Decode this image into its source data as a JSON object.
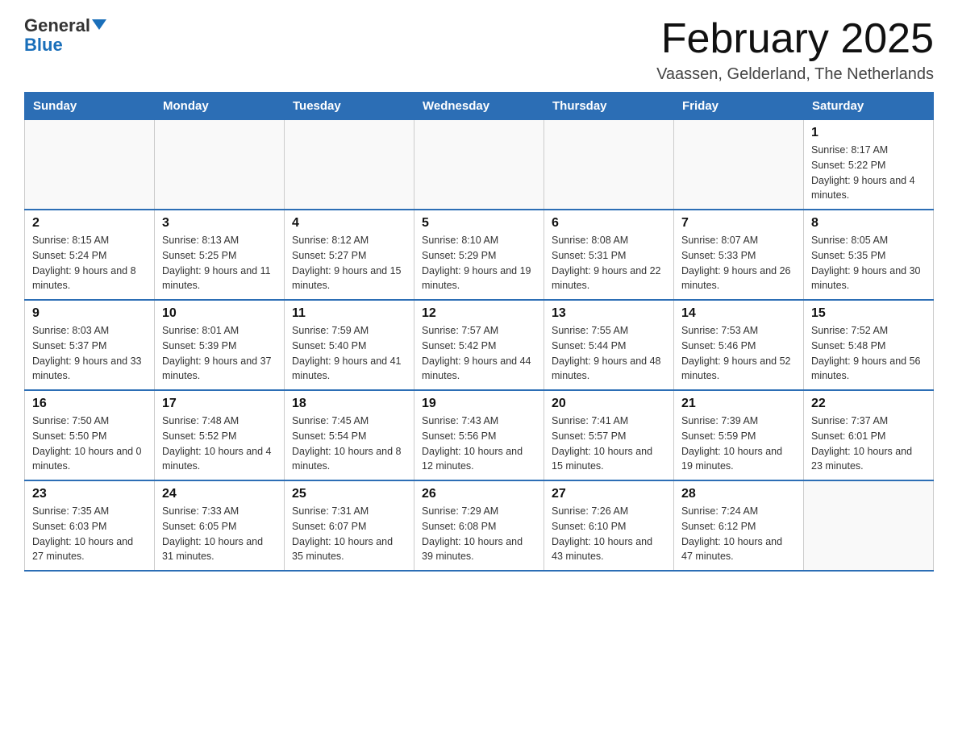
{
  "header": {
    "logo_general": "General",
    "logo_blue": "Blue",
    "month_title": "February 2025",
    "location": "Vaassen, Gelderland, The Netherlands"
  },
  "days_of_week": [
    "Sunday",
    "Monday",
    "Tuesday",
    "Wednesday",
    "Thursday",
    "Friday",
    "Saturday"
  ],
  "weeks": [
    [
      {
        "day": "",
        "info": ""
      },
      {
        "day": "",
        "info": ""
      },
      {
        "day": "",
        "info": ""
      },
      {
        "day": "",
        "info": ""
      },
      {
        "day": "",
        "info": ""
      },
      {
        "day": "",
        "info": ""
      },
      {
        "day": "1",
        "info": "Sunrise: 8:17 AM\nSunset: 5:22 PM\nDaylight: 9 hours and 4 minutes."
      }
    ],
    [
      {
        "day": "2",
        "info": "Sunrise: 8:15 AM\nSunset: 5:24 PM\nDaylight: 9 hours and 8 minutes."
      },
      {
        "day": "3",
        "info": "Sunrise: 8:13 AM\nSunset: 5:25 PM\nDaylight: 9 hours and 11 minutes."
      },
      {
        "day": "4",
        "info": "Sunrise: 8:12 AM\nSunset: 5:27 PM\nDaylight: 9 hours and 15 minutes."
      },
      {
        "day": "5",
        "info": "Sunrise: 8:10 AM\nSunset: 5:29 PM\nDaylight: 9 hours and 19 minutes."
      },
      {
        "day": "6",
        "info": "Sunrise: 8:08 AM\nSunset: 5:31 PM\nDaylight: 9 hours and 22 minutes."
      },
      {
        "day": "7",
        "info": "Sunrise: 8:07 AM\nSunset: 5:33 PM\nDaylight: 9 hours and 26 minutes."
      },
      {
        "day": "8",
        "info": "Sunrise: 8:05 AM\nSunset: 5:35 PM\nDaylight: 9 hours and 30 minutes."
      }
    ],
    [
      {
        "day": "9",
        "info": "Sunrise: 8:03 AM\nSunset: 5:37 PM\nDaylight: 9 hours and 33 minutes."
      },
      {
        "day": "10",
        "info": "Sunrise: 8:01 AM\nSunset: 5:39 PM\nDaylight: 9 hours and 37 minutes."
      },
      {
        "day": "11",
        "info": "Sunrise: 7:59 AM\nSunset: 5:40 PM\nDaylight: 9 hours and 41 minutes."
      },
      {
        "day": "12",
        "info": "Sunrise: 7:57 AM\nSunset: 5:42 PM\nDaylight: 9 hours and 44 minutes."
      },
      {
        "day": "13",
        "info": "Sunrise: 7:55 AM\nSunset: 5:44 PM\nDaylight: 9 hours and 48 minutes."
      },
      {
        "day": "14",
        "info": "Sunrise: 7:53 AM\nSunset: 5:46 PM\nDaylight: 9 hours and 52 minutes."
      },
      {
        "day": "15",
        "info": "Sunrise: 7:52 AM\nSunset: 5:48 PM\nDaylight: 9 hours and 56 minutes."
      }
    ],
    [
      {
        "day": "16",
        "info": "Sunrise: 7:50 AM\nSunset: 5:50 PM\nDaylight: 10 hours and 0 minutes."
      },
      {
        "day": "17",
        "info": "Sunrise: 7:48 AM\nSunset: 5:52 PM\nDaylight: 10 hours and 4 minutes."
      },
      {
        "day": "18",
        "info": "Sunrise: 7:45 AM\nSunset: 5:54 PM\nDaylight: 10 hours and 8 minutes."
      },
      {
        "day": "19",
        "info": "Sunrise: 7:43 AM\nSunset: 5:56 PM\nDaylight: 10 hours and 12 minutes."
      },
      {
        "day": "20",
        "info": "Sunrise: 7:41 AM\nSunset: 5:57 PM\nDaylight: 10 hours and 15 minutes."
      },
      {
        "day": "21",
        "info": "Sunrise: 7:39 AM\nSunset: 5:59 PM\nDaylight: 10 hours and 19 minutes."
      },
      {
        "day": "22",
        "info": "Sunrise: 7:37 AM\nSunset: 6:01 PM\nDaylight: 10 hours and 23 minutes."
      }
    ],
    [
      {
        "day": "23",
        "info": "Sunrise: 7:35 AM\nSunset: 6:03 PM\nDaylight: 10 hours and 27 minutes."
      },
      {
        "day": "24",
        "info": "Sunrise: 7:33 AM\nSunset: 6:05 PM\nDaylight: 10 hours and 31 minutes."
      },
      {
        "day": "25",
        "info": "Sunrise: 7:31 AM\nSunset: 6:07 PM\nDaylight: 10 hours and 35 minutes."
      },
      {
        "day": "26",
        "info": "Sunrise: 7:29 AM\nSunset: 6:08 PM\nDaylight: 10 hours and 39 minutes."
      },
      {
        "day": "27",
        "info": "Sunrise: 7:26 AM\nSunset: 6:10 PM\nDaylight: 10 hours and 43 minutes."
      },
      {
        "day": "28",
        "info": "Sunrise: 7:24 AM\nSunset: 6:12 PM\nDaylight: 10 hours and 47 minutes."
      },
      {
        "day": "",
        "info": ""
      }
    ]
  ]
}
